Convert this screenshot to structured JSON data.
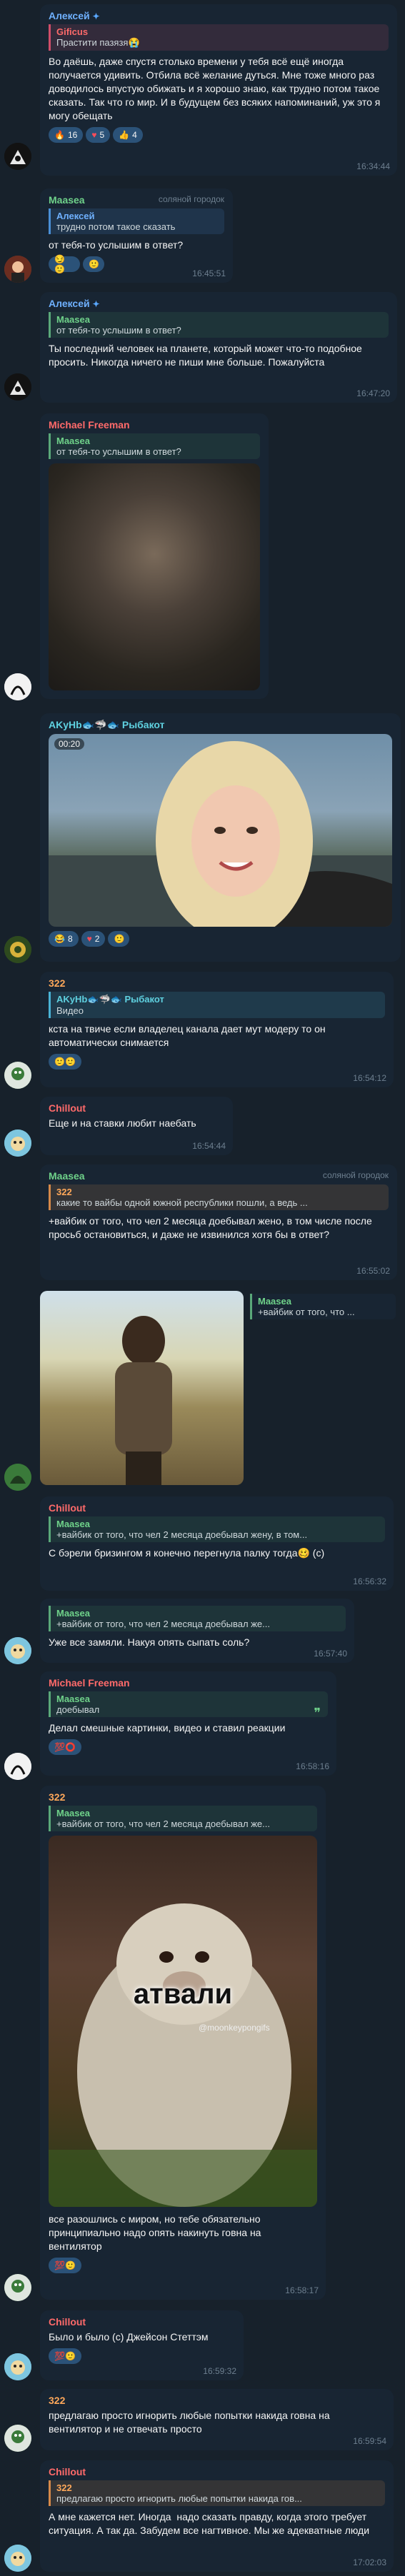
{
  "messages": {
    "m1": {
      "sender": "Алексей",
      "reply_name": "Gificus",
      "reply_text": "Прастити пазязя😭",
      "text": "Во даёшь, даже спустя столько времени у тебя всё ещё иногда получается удивить. Отбила всё желание дуться. Мне тоже много раз доводилось впустую обижать и я хорошо знаю, как трудно потом такое сказать. Так что го мир. И в будущем без всяких напоминаний, уж это я могу обещать",
      "time": "16:34:44",
      "reactions": [
        "16",
        "5",
        "4"
      ]
    },
    "m2": {
      "sender": "Maasea",
      "aux": "соляной городок",
      "reply_name": "Алексей",
      "reply_text": "трудно потом такое сказать",
      "text": "от тебя-то услышим в ответ?",
      "time": "16:45:51"
    },
    "m3": {
      "sender": "Алексей",
      "reply_name": "Maasea",
      "reply_text": "от тебя-то услышим в ответ?",
      "text": "Ты последний человек на планете, который может что-то подобное просить. Никогда ничего не пиши мне больше. Пожалуйста",
      "time": "16:47:20"
    },
    "m4": {
      "sender": "Michael Freeman",
      "reply_name": "Maasea",
      "reply_text": "от тебя-то услышим в ответ?"
    },
    "m5": {
      "sender": "AKyHb🐟🦈🐟 Рыбакот",
      "video_time": "00:20",
      "reactions": [
        "8",
        "2"
      ]
    },
    "m6": {
      "sender": "322",
      "reply_name": "AKyHb🐟🦈🐟 Рыбакот",
      "reply_text": "Видео",
      "text": "кста на твиче если владелец канала дает мут модеру то он автоматически снимается",
      "time": "16:54:12"
    },
    "m7": {
      "sender": "Chillout",
      "text": "Еще и на ставки любит наебать",
      "time": "16:54:44"
    },
    "m8": {
      "sender": "Maasea",
      "aux": "соляной городок",
      "reply_name": "322",
      "reply_text": "какие то вайбы одной южной республики пошли, а ведь ...",
      "text": "+вайбик от того, что чел 2 месяца доебывал жено, в том числе после просьб остановиться, и даже не извинился хотя бы в ответ?",
      "time": "16:55:02"
    },
    "m9": {
      "reply_name": "Maasea",
      "reply_text": "+вайбик от того, что ..."
    },
    "m10": {
      "sender": "Chillout",
      "reply_name": "Maasea",
      "reply_text": "+вайбик от того, что чел 2 месяца доебывал жену, в том...",
      "text": "С бэрели бризингом я конечно перегнула палку тогда🥴 (с)",
      "time": "16:56:32"
    },
    "m11": {
      "reply_name": "Maasea",
      "reply_text": "+вайбик от того, что чел 2 месяца доебывал же...",
      "text": "Уже все замяли. Накуя опять сыпать соль?",
      "time": "16:57:40"
    },
    "m12": {
      "sender": "Michael Freeman",
      "reply_name": "Maasea",
      "reply_text": "доебывал",
      "text": "Делал смешные картинки, видео и ставил реакции",
      "time": "16:58:16"
    },
    "m13": {
      "sender": "322",
      "reply_name": "Maasea",
      "reply_text": "+вайбик от того, что чел 2 месяца доебывал же...",
      "caption": "атвали",
      "watermark": "@moonkeypongifs",
      "text": "все разошлись с миром, но тебе обязательно принципиально надо опять накинуть говна на вентилятор",
      "time": "16:58:17"
    },
    "m14": {
      "sender": "Chillout",
      "text": "Было и было (с) Джейсон Стеттэм",
      "time": "16:59:32"
    },
    "m15": {
      "sender": "322",
      "text": "предлагаю просто игнорить любые попытки накида говна на вентилятор и не отвечать просто",
      "time": "16:59:54"
    },
    "m16": {
      "sender": "Chillout",
      "reply_name": "322",
      "reply_text": "предлагаю просто игнорить любые попытки накида гов...",
      "text": "А мне кажется нет. Иногда  надо сказать правду, когда этого требует ситуация. А так да. Забудем все нагтивное. Мы же адекватные люди",
      "time": "17:02:03"
    }
  },
  "icons": [
    "verified-star-icon",
    "double-check-icon",
    "quote-icon",
    "heart-icon",
    "thumbs-up-icon",
    "fire-icon"
  ],
  "colors": {
    "bg": "#17212b",
    "bubble": "#182533",
    "accent": "#5aa8ff",
    "reply_bar": "#5aa87a"
  }
}
